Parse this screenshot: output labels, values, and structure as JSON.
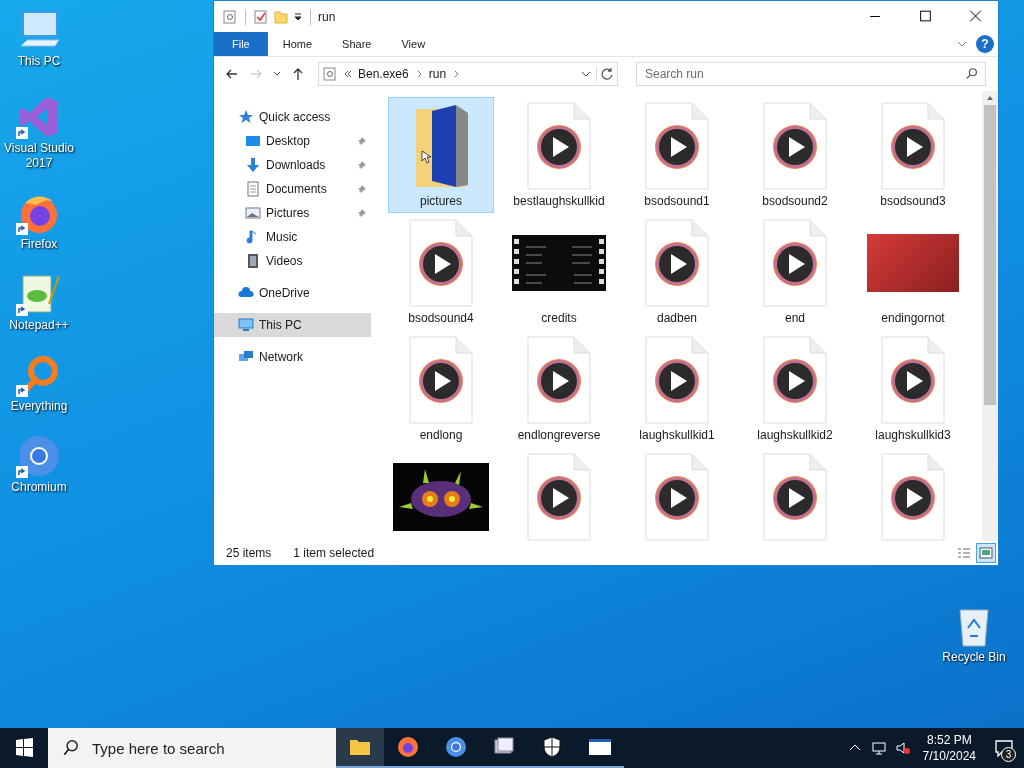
{
  "desktop_icons": [
    {
      "label": "This PC",
      "kind": "pc",
      "shortcut": false
    },
    {
      "label": "Visual Studio 2017",
      "kind": "vs",
      "shortcut": true
    },
    {
      "label": "Firefox",
      "kind": "firefox",
      "shortcut": true
    },
    {
      "label": "Notepad++",
      "kind": "notepad",
      "shortcut": true
    },
    {
      "label": "Everything",
      "kind": "everything",
      "shortcut": true
    },
    {
      "label": "Chromium",
      "kind": "chromium",
      "shortcut": true
    }
  ],
  "recycle_bin": {
    "label": "Recycle Bin"
  },
  "window": {
    "title": "run",
    "ribbon_tabs": [
      {
        "label": "File",
        "selected": true
      },
      {
        "label": "Home",
        "selected": false
      },
      {
        "label": "Share",
        "selected": false
      },
      {
        "label": "View",
        "selected": false
      }
    ],
    "help": {
      "label": "?"
    },
    "address": {
      "segments": [
        "Ben.exe6",
        "run"
      ]
    },
    "search": {
      "placeholder": "Search run"
    },
    "nav": [
      {
        "label": "Quick access",
        "kind": "star",
        "selected": false,
        "children": [
          {
            "label": "Desktop",
            "kind": "desktop",
            "pinned": true,
            "selected": false
          },
          {
            "label": "Downloads",
            "kind": "download",
            "pinned": true,
            "selected": false
          },
          {
            "label": "Documents",
            "kind": "documents",
            "pinned": true,
            "selected": false
          },
          {
            "label": "Pictures",
            "kind": "pictures",
            "pinned": true,
            "selected": false
          },
          {
            "label": "Music",
            "kind": "music",
            "pinned": false,
            "selected": false
          },
          {
            "label": "Videos",
            "kind": "videos",
            "pinned": false,
            "selected": false
          }
        ]
      },
      {
        "label": "OneDrive",
        "kind": "cloud",
        "selected": false
      },
      {
        "label": "This PC",
        "kind": "pc",
        "selected": true
      },
      {
        "label": "Network",
        "kind": "network",
        "selected": false
      }
    ],
    "files": [
      {
        "name": "pictures",
        "kind": "folder",
        "selected": true
      },
      {
        "name": "bestlaughskullkid",
        "kind": "audio",
        "selected": false
      },
      {
        "name": "bsodsound1",
        "kind": "audio",
        "selected": false
      },
      {
        "name": "bsodsound2",
        "kind": "audio",
        "selected": false
      },
      {
        "name": "bsodsound3",
        "kind": "audio",
        "selected": false
      },
      {
        "name": "bsodsound4",
        "kind": "audio",
        "selected": false
      },
      {
        "name": "credits",
        "kind": "video",
        "selected": false
      },
      {
        "name": "dadben",
        "kind": "audio",
        "selected": false
      },
      {
        "name": "end",
        "kind": "audio",
        "selected": false
      },
      {
        "name": "endingornot",
        "kind": "photo",
        "selected": false
      },
      {
        "name": "endlong",
        "kind": "audio",
        "selected": false
      },
      {
        "name": "endlongreverse",
        "kind": "audio",
        "selected": false
      },
      {
        "name": "laughskullkid1",
        "kind": "audio",
        "selected": false
      },
      {
        "name": "laughskullkid2",
        "kind": "audio",
        "selected": false
      },
      {
        "name": "laughskullkid3",
        "kind": "audio",
        "selected": false
      },
      {
        "kind": "mask",
        "selected": false
      },
      {
        "kind": "audio",
        "selected": false
      },
      {
        "kind": "audio",
        "selected": false
      },
      {
        "kind": "audio",
        "selected": false
      },
      {
        "kind": "audio",
        "selected": false
      }
    ],
    "status": {
      "count": "25 items",
      "selection": "1 item selected"
    },
    "view_buttons": [
      {
        "kind": "details",
        "selected": false
      },
      {
        "kind": "large",
        "selected": true
      }
    ]
  },
  "taskbar": {
    "search_placeholder": "Type here to search",
    "apps": [
      {
        "kind": "explorer",
        "selected": true
      },
      {
        "kind": "firefox",
        "selected": false
      },
      {
        "kind": "chromium",
        "selected": false
      },
      {
        "kind": "photos",
        "selected": false
      },
      {
        "kind": "security",
        "selected": false
      },
      {
        "kind": "window",
        "selected": false
      }
    ],
    "time": "8:52 PM",
    "date": "7/10/2024",
    "notifications": "3"
  }
}
